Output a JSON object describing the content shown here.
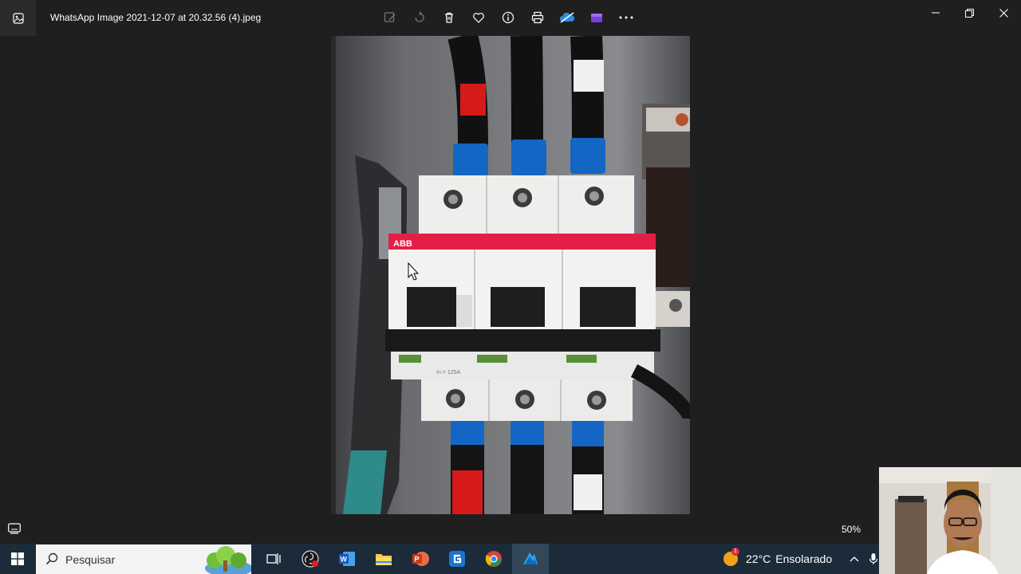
{
  "window": {
    "title": "WhatsApp Image 2021-12-07 at 20.32.56 (4).jpeg",
    "toolbar": [
      "edit-image-icon",
      "rotate-icon",
      "delete-icon",
      "favorite-icon",
      "info-icon",
      "print-icon",
      "onedrive-icon",
      "clipchamp-icon",
      "more-icon"
    ],
    "controls": [
      "minimize-icon",
      "maximize-icon",
      "close-icon"
    ]
  },
  "photo": {
    "subject": "three-pole breaker",
    "brand_label": "ABB",
    "rating_label": "In = 125A"
  },
  "bottom": {
    "zoom": "50%"
  },
  "taskbar": {
    "search_placeholder": "Pesquisar",
    "weather": {
      "temp": "22°C",
      "condition": "Ensolarado",
      "badge": "1"
    },
    "apps": [
      "task-view-icon",
      "obs-icon",
      "word-icon",
      "file-explorer-icon",
      "powerpoint-icon",
      "g-app-icon",
      "chrome-icon",
      "paint-icon"
    ]
  }
}
